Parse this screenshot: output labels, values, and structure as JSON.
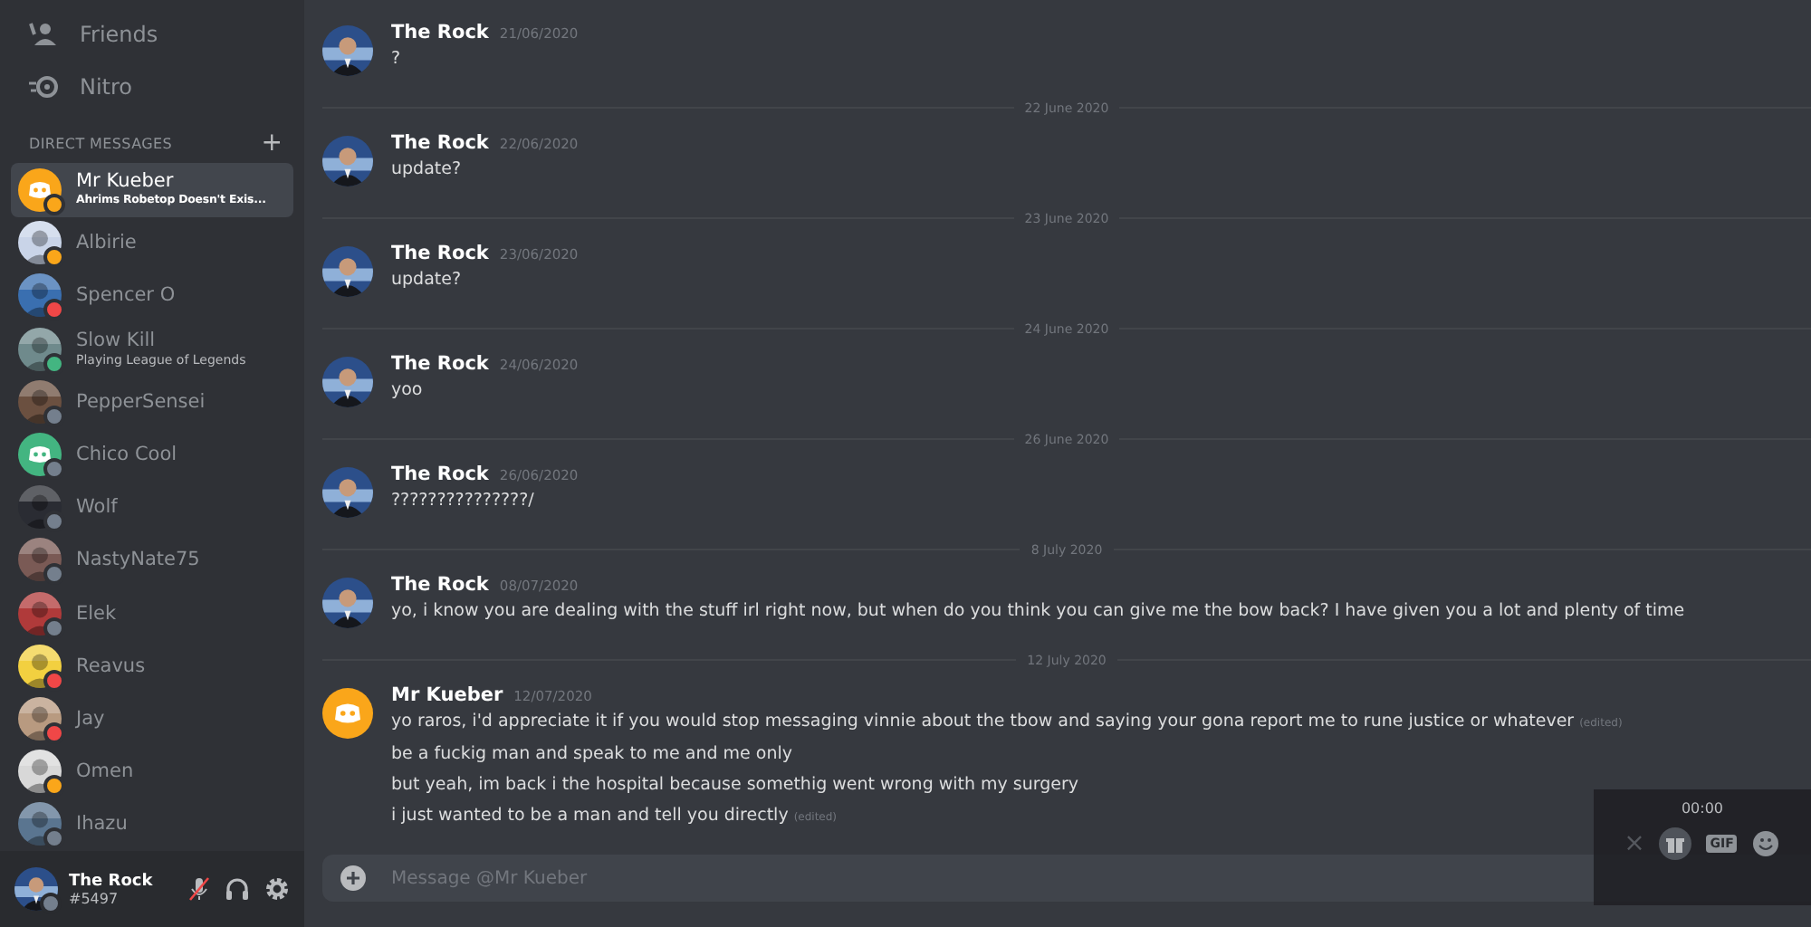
{
  "sidebar": {
    "nav": [
      {
        "kind": "friends",
        "label": "Friends"
      },
      {
        "kind": "nitro",
        "label": "Nitro"
      }
    ],
    "section_title": "DIRECT MESSAGES",
    "add_label": "+",
    "items": [
      {
        "name": "Mr Kueber",
        "status_text": "Ahrims Robetop Doesn't Exis...",
        "selected": true,
        "color": "#faa61a",
        "kind": "default"
      },
      {
        "name": "Albirie",
        "selected": false,
        "color": "#faa61a",
        "kind": "picture"
      },
      {
        "name": "Spencer O",
        "selected": false,
        "color": "#f04747",
        "kind": "picture"
      },
      {
        "name": "Slow Kill",
        "status_text": "Playing League of Legends",
        "selected": false,
        "color": "#43b581",
        "kind": "picture"
      },
      {
        "name": "PepperSensei",
        "selected": false,
        "color": "#747f8d",
        "kind": "picture"
      },
      {
        "name": "Chico Cool",
        "selected": false,
        "color": "#747f8d",
        "kind": "default"
      },
      {
        "name": "Wolf",
        "selected": false,
        "color": "#747f8d",
        "kind": "picture"
      },
      {
        "name": "NastyNate75",
        "selected": false,
        "color": "#747f8d",
        "kind": "picture"
      },
      {
        "name": "Elek",
        "selected": false,
        "color": "#747f8d",
        "kind": "picture"
      },
      {
        "name": "Reavus",
        "selected": false,
        "color": "#f04747",
        "kind": "picture"
      },
      {
        "name": "Jay",
        "selected": false,
        "color": "#f04747",
        "kind": "picture"
      },
      {
        "name": "Omen",
        "selected": false,
        "color": "#faa61a",
        "kind": "picture"
      },
      {
        "name": "Ihazu",
        "selected": false,
        "color": "#747f8d",
        "kind": "picture"
      }
    ],
    "user": {
      "name": "The Rock",
      "tag": "#5497",
      "color": "#747f8d"
    }
  },
  "messages": [
    {
      "kind": "message",
      "author": "The Rock",
      "time": "21/06/2020",
      "lines": [
        {
          "text": "?"
        }
      ]
    },
    {
      "kind": "divider",
      "label": "22 June 2020"
    },
    {
      "kind": "message",
      "author": "The Rock",
      "time": "22/06/2020",
      "lines": [
        {
          "text": "update?"
        }
      ]
    },
    {
      "kind": "divider",
      "label": "23 June 2020"
    },
    {
      "kind": "message",
      "author": "The Rock",
      "time": "23/06/2020",
      "lines": [
        {
          "text": "update?"
        }
      ]
    },
    {
      "kind": "divider",
      "label": "24 June 2020"
    },
    {
      "kind": "message",
      "author": "The Rock",
      "time": "24/06/2020",
      "lines": [
        {
          "text": "yoo"
        }
      ]
    },
    {
      "kind": "divider",
      "label": "26 June 2020"
    },
    {
      "kind": "message",
      "author": "The Rock",
      "time": "26/06/2020",
      "lines": [
        {
          "text": "???????????????/"
        }
      ]
    },
    {
      "kind": "divider",
      "label": "8 July 2020"
    },
    {
      "kind": "message",
      "author": "The Rock",
      "time": "08/07/2020",
      "lines": [
        {
          "text": "yo, i know you are dealing with the stuff irl right now, but when do you think you can give me the bow back? I have given you a lot and plenty of time"
        }
      ]
    },
    {
      "kind": "divider",
      "label": "12 July 2020"
    },
    {
      "kind": "default_message",
      "author": "Mr Kueber",
      "time": "12/07/2020",
      "lines": [
        {
          "text": "yo raros, i'd appreciate it if you would stop messaging vinnie about the tbow and saying your gona report me to rune justice or whatever",
          "edited": "(edited)"
        },
        {
          "text": "be a fuckig man and speak to me and me only"
        },
        {
          "text": "but yeah, im back i the hospital because somethig went wrong with my surgery"
        },
        {
          "text": "i just wanted to be a man and tell you directly",
          "edited": "(edited)"
        }
      ]
    }
  ],
  "input": {
    "placeholder": "Message @Mr Kueber"
  },
  "recorder": {
    "time": "00:00",
    "close_label": "×",
    "gif_label": "GIF"
  }
}
